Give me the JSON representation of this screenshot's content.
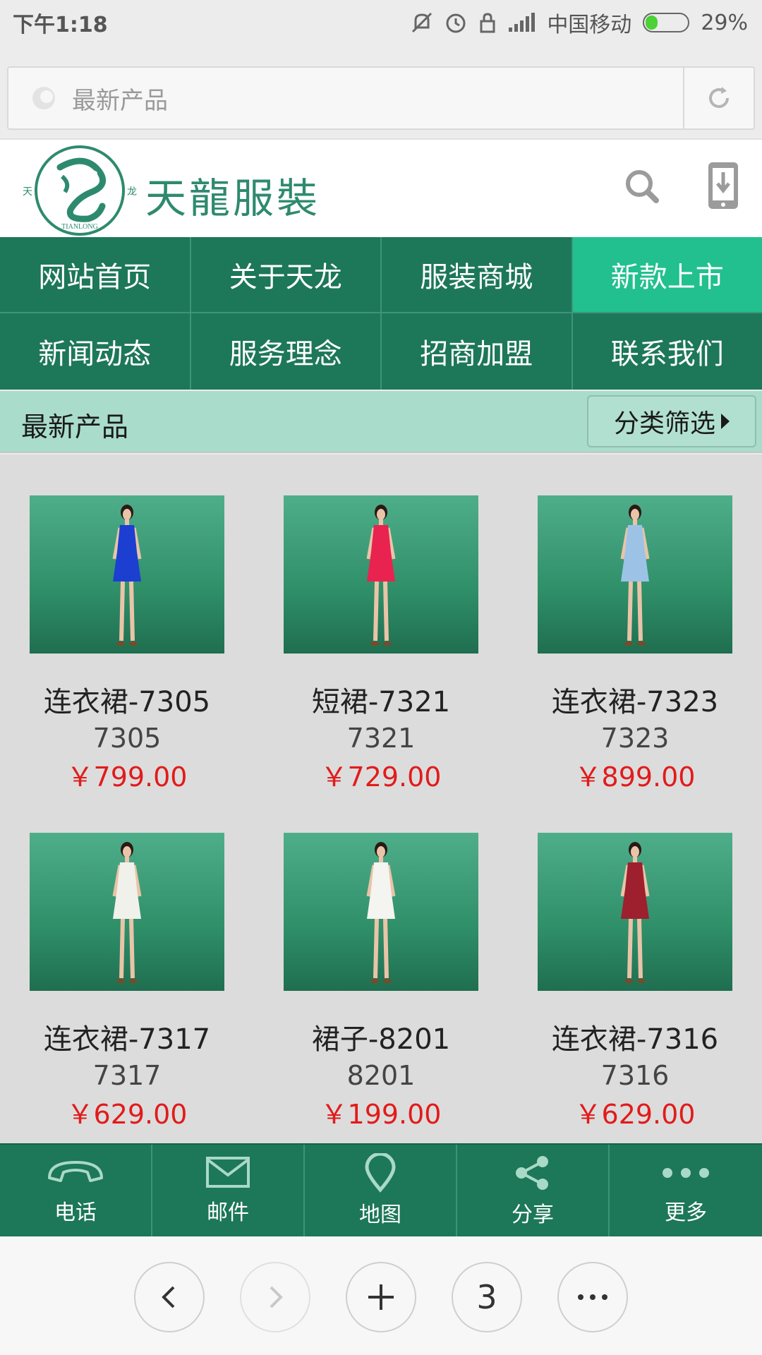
{
  "status": {
    "time": "下午1:18",
    "carrier": "中国移动",
    "battery_text": "29%",
    "battery_level": 0.29
  },
  "browser": {
    "url_text": "最新产品",
    "tab_count": "3"
  },
  "site": {
    "brand": "天龍服裝",
    "logo_side_left": "天",
    "logo_side_right": "龙",
    "logo_text": "TIANLONG"
  },
  "nav": [
    {
      "label": "网站首页",
      "active": false
    },
    {
      "label": "关于天龙",
      "active": false
    },
    {
      "label": "服装商城",
      "active": false
    },
    {
      "label": "新款上市",
      "active": true
    },
    {
      "label": "新闻动态",
      "active": false
    },
    {
      "label": "服务理念",
      "active": false
    },
    {
      "label": "招商加盟",
      "active": false
    },
    {
      "label": "联系我们",
      "active": false
    }
  ],
  "section": {
    "title": "最新产品",
    "filter_label": "分类筛选"
  },
  "products": [
    {
      "name": "连衣裙-7305",
      "code": "7305",
      "price": "￥799.00",
      "dress_color": "#1c3fd1"
    },
    {
      "name": "短裙-7321",
      "code": "7321",
      "price": "￥729.00",
      "dress_color": "#e8234f"
    },
    {
      "name": "连衣裙-7323",
      "code": "7323",
      "price": "￥899.00",
      "dress_color": "#9cc3e6"
    },
    {
      "name": "连衣裙-7317",
      "code": "7317",
      "price": "￥629.00",
      "dress_color": "#f1f1ec"
    },
    {
      "name": "裙子-8201",
      "code": "8201",
      "price": "￥199.00",
      "dress_color": "#f4f4f0"
    },
    {
      "name": "连衣裙-7316",
      "code": "7316",
      "price": "￥629.00",
      "dress_color": "#9e1f2e"
    }
  ],
  "actions": [
    {
      "label": "电话",
      "icon": "phone-icon"
    },
    {
      "label": "邮件",
      "icon": "mail-icon"
    },
    {
      "label": "地图",
      "icon": "map-pin-icon"
    },
    {
      "label": "分享",
      "icon": "share-icon"
    },
    {
      "label": "更多",
      "icon": "more-icon"
    }
  ],
  "colors": {
    "primary_green": "#1d7759",
    "active_green": "#22c08e",
    "section_bg": "#a9dccb",
    "price_red": "#e21b1b"
  }
}
